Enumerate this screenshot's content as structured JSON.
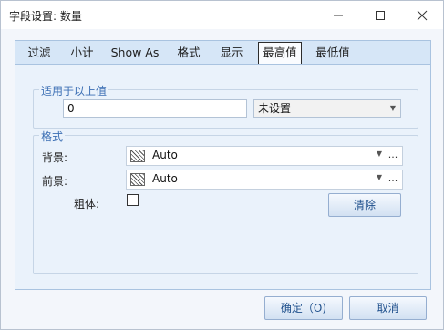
{
  "window": {
    "title": "字段设置: 数量",
    "minimize_glyph": "—",
    "maximize_glyph": "☐",
    "close_glyph": "✕"
  },
  "tabs": [
    {
      "label": "过滤"
    },
    {
      "label": "小计"
    },
    {
      "label": "Show As"
    },
    {
      "label": "格式"
    },
    {
      "label": "显示"
    },
    {
      "label": "最高值",
      "active": true
    },
    {
      "label": "最低值"
    }
  ],
  "applies_group": {
    "legend": "适用于以上值",
    "value": "0",
    "condition": "未设置"
  },
  "format_group": {
    "legend": "格式",
    "background_label": "背景:",
    "background_value": "Auto",
    "foreground_label": "前景:",
    "foreground_value": "Auto",
    "bold_label": "粗体:",
    "bold_checked": false,
    "clear_label": "清除",
    "ellipsis": "..."
  },
  "footer": {
    "ok_label": "确定（O)",
    "cancel_label": "取消"
  }
}
